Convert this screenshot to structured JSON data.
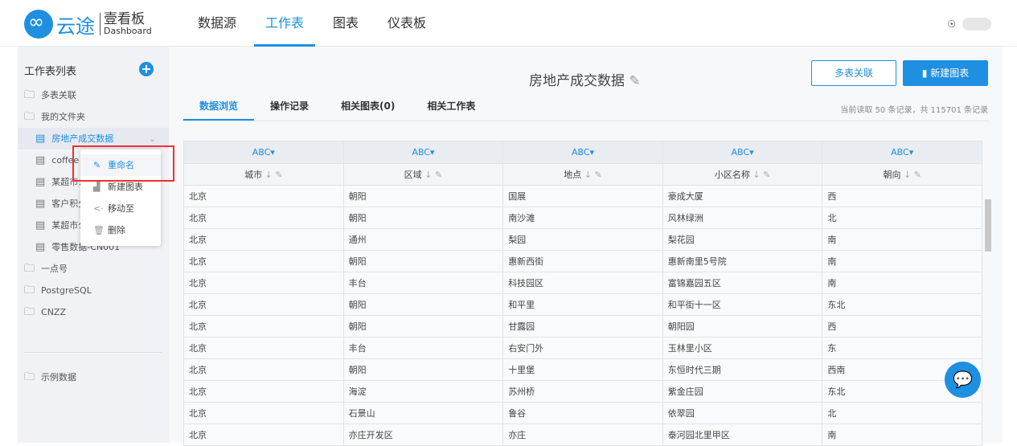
{
  "header": {
    "logo_name": "云途",
    "logo_title": "壹看板",
    "logo_sub": "Dashboard",
    "nav": [
      "数据源",
      "工作表",
      "图表",
      "仪表板"
    ],
    "active_nav": 1
  },
  "sidebar": {
    "title": "工作表列表",
    "items": [
      {
        "label": "多表关联",
        "type": "folder"
      },
      {
        "label": "我的文件夹",
        "type": "folder-open"
      },
      {
        "label": "房地产成交数据",
        "type": "file",
        "active": true
      },
      {
        "label": "coffee c",
        "type": "file"
      },
      {
        "label": "某超市公",
        "type": "file"
      },
      {
        "label": "客户积分",
        "type": "file"
      },
      {
        "label": "某超市公",
        "type": "file"
      },
      {
        "label": "零售数据-CN001",
        "type": "file"
      },
      {
        "label": "一点号",
        "type": "folder"
      },
      {
        "label": "PostgreSQL",
        "type": "folder"
      },
      {
        "label": "CNZZ",
        "type": "folder"
      }
    ],
    "sample": "示例数据"
  },
  "context_menu": [
    "重命名",
    "新建图表",
    "移动至",
    "删除"
  ],
  "main": {
    "title": "房地产成交数据",
    "btn_join": "多表关联",
    "btn_new": "新建图表",
    "tabs": [
      "数据浏览",
      "操作记录",
      "相关图表(0)",
      "相关工作表"
    ],
    "count": "当前读取 50 条记录，共 115701 条记录",
    "type_label": "ABC▾",
    "columns": [
      "城市",
      "区域",
      "地点",
      "小区名称",
      "朝向"
    ],
    "rows": [
      [
        "北京",
        "朝阳",
        "国展",
        "豪成大厦",
        "西"
      ],
      [
        "北京",
        "朝阳",
        "南沙滩",
        "风林绿洲",
        "北"
      ],
      [
        "北京",
        "通州",
        "梨园",
        "梨花园",
        "南"
      ],
      [
        "北京",
        "朝阳",
        "惠新西街",
        "惠新南里5号院",
        "南"
      ],
      [
        "北京",
        "丰台",
        "科技园区",
        "富锦嘉园五区",
        "南"
      ],
      [
        "北京",
        "朝阳",
        "和平里",
        "和平街十一区",
        "东北"
      ],
      [
        "北京",
        "朝阳",
        "甘露园",
        "朝阳园",
        "西"
      ],
      [
        "北京",
        "丰台",
        "右安门外",
        "玉林里小区",
        "东"
      ],
      [
        "北京",
        "朝阳",
        "十里堡",
        "东恒时代三期",
        "西南"
      ],
      [
        "北京",
        "海淀",
        "苏州桥",
        "紫金庄园",
        "东北"
      ],
      [
        "北京",
        "石景山",
        "鲁谷",
        "依翠园",
        "北"
      ],
      [
        "北京",
        "亦庄开发区",
        "亦庄",
        "泰河园北里甲区",
        "南"
      ]
    ]
  }
}
